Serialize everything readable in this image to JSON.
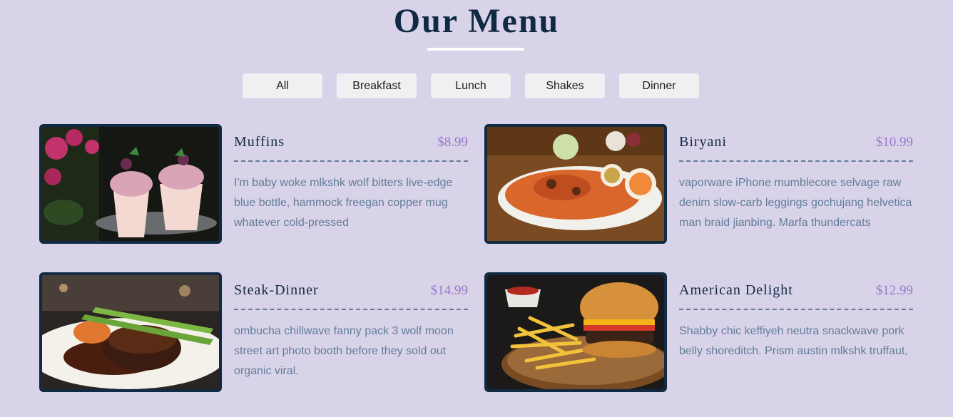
{
  "header": {
    "title": "Our Menu"
  },
  "filters": [
    "All",
    "Breakfast",
    "Lunch",
    "Shakes",
    "Dinner"
  ],
  "items": [
    {
      "name": "Muffins",
      "price": "$8.99",
      "image": "muffins-photo",
      "desc": "I'm baby woke mlkshk wolf bitters live-edge blue bottle, hammock freegan copper mug whatever cold-pressed"
    },
    {
      "name": "Biryani",
      "price": "$10.99",
      "image": "biryani-photo",
      "desc": "vaporware iPhone mumblecore selvage raw denim slow-carb leggings gochujang helvetica man braid jianbing. Marfa thundercats"
    },
    {
      "name": "Steak-Dinner",
      "price": "$14.99",
      "image": "steak-photo",
      "desc": "ombucha chillwave fanny pack 3 wolf moon street art photo booth before they sold out organic viral."
    },
    {
      "name": "American Delight",
      "price": "$12.99",
      "image": "burger-photo",
      "desc": "Shabby chic keffiyeh neutra snackwave pork belly shoreditch. Prism austin mlkshk truffaut,"
    }
  ],
  "colors": {
    "background": "#d9d3ea",
    "price": "#9a76c9",
    "text": "#617d98",
    "heading": "#102a43"
  }
}
